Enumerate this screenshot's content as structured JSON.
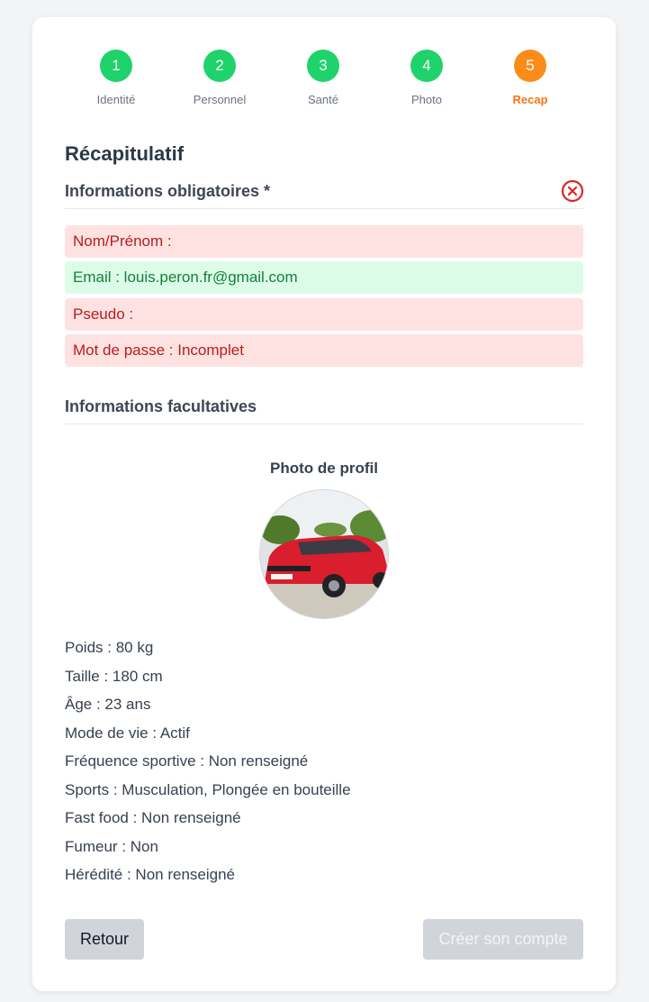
{
  "steps": [
    {
      "num": "1",
      "label": "Identité"
    },
    {
      "num": "2",
      "label": "Personnel"
    },
    {
      "num": "3",
      "label": "Santé"
    },
    {
      "num": "4",
      "label": "Photo"
    },
    {
      "num": "5",
      "label": "Recap"
    }
  ],
  "active_step": 5,
  "title": "Récapitulatif",
  "required_section": {
    "title": "Informations obligatoires *",
    "status_icon": "close-circle-icon",
    "fields": [
      {
        "text": "Nom/Prénom :",
        "status": "error"
      },
      {
        "text": "Email : louis.peron.fr@gmail.com",
        "status": "ok"
      },
      {
        "text": "Pseudo :",
        "status": "error"
      },
      {
        "text": "Mot de passe : Incomplet",
        "status": "error"
      }
    ]
  },
  "optional_section": {
    "title": "Informations facultatives",
    "photo_title": "Photo de profil",
    "details": [
      "Poids : 80 kg",
      "Taille : 180 cm",
      "Âge : 23 ans",
      "Mode de vie : Actif",
      "Fréquence sportive : Non renseigné",
      "Sports : Musculation, Plongée en bouteille",
      "Fast food : Non renseigné",
      "Fumeur : Non",
      "Hérédité : Non renseigné"
    ]
  },
  "buttons": {
    "back": "Retour",
    "create": "Créer son compte"
  },
  "colors": {
    "step_done": "#1fd36b",
    "step_active": "#fb8c1a",
    "error_bg": "#fee2e2",
    "error_text": "#b91c1c",
    "ok_bg": "#dcfce7",
    "ok_text": "#15803d"
  }
}
